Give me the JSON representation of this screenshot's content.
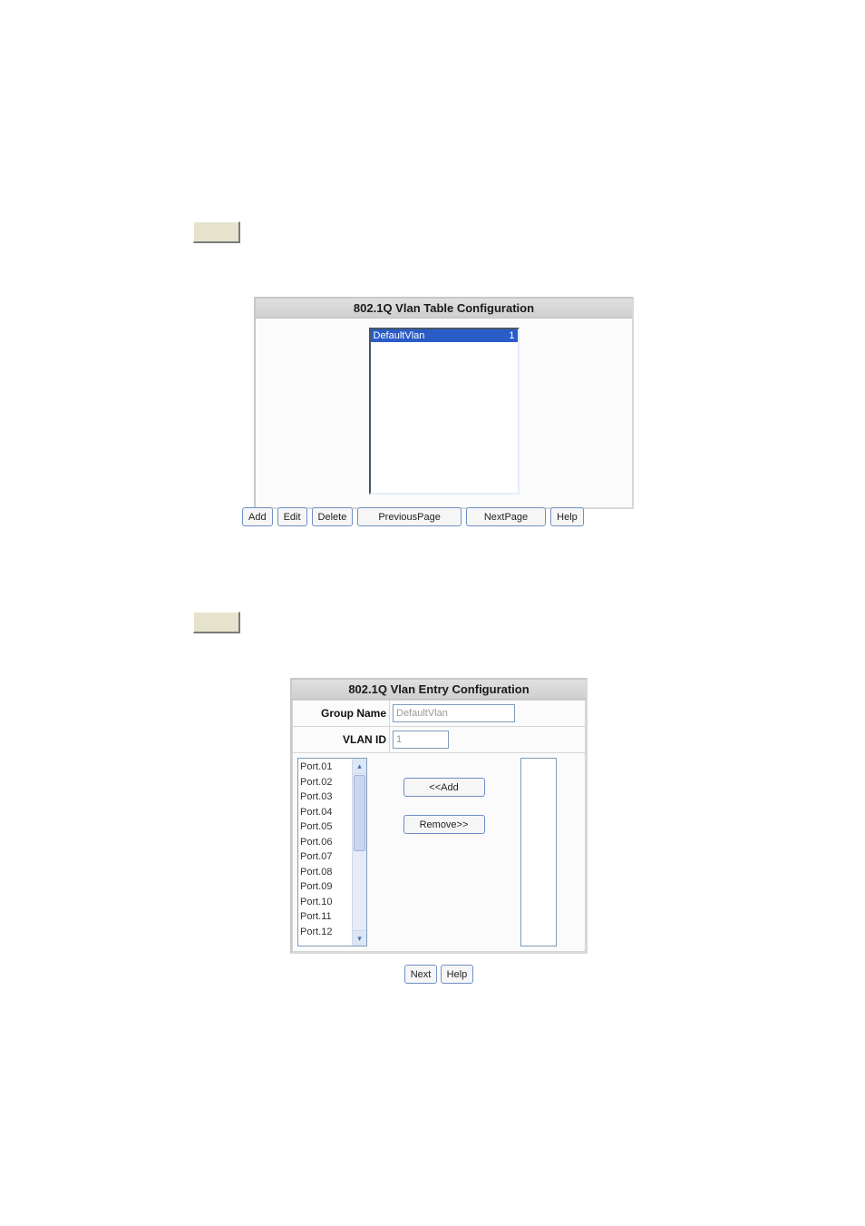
{
  "placeholder1": "",
  "placeholder2": "",
  "table_panel": {
    "title": "802.1Q Vlan Table Configuration",
    "entries": [
      {
        "name": "DefaultVlan",
        "id": "1",
        "selected": true
      }
    ],
    "buttons": {
      "add": "Add",
      "edit": "Edit",
      "delete": "Delete",
      "prev": "PreviousPage",
      "next": "NextPage",
      "help": "Help"
    }
  },
  "entry_panel": {
    "title": "802.1Q Vlan Entry Configuration",
    "labels": {
      "group_name": "Group Name",
      "vlan_id": "VLAN ID"
    },
    "values": {
      "group_name": "DefaultVlan",
      "vlan_id": "1"
    },
    "ports": [
      "Port.01",
      "Port.02",
      "Port.03",
      "Port.04",
      "Port.05",
      "Port.06",
      "Port.07",
      "Port.08",
      "Port.09",
      "Port.10",
      "Port.11",
      "Port.12"
    ],
    "buttons": {
      "add_move": "<<Add",
      "remove_move": "Remove>>",
      "next": "Next",
      "help": "Help"
    }
  }
}
